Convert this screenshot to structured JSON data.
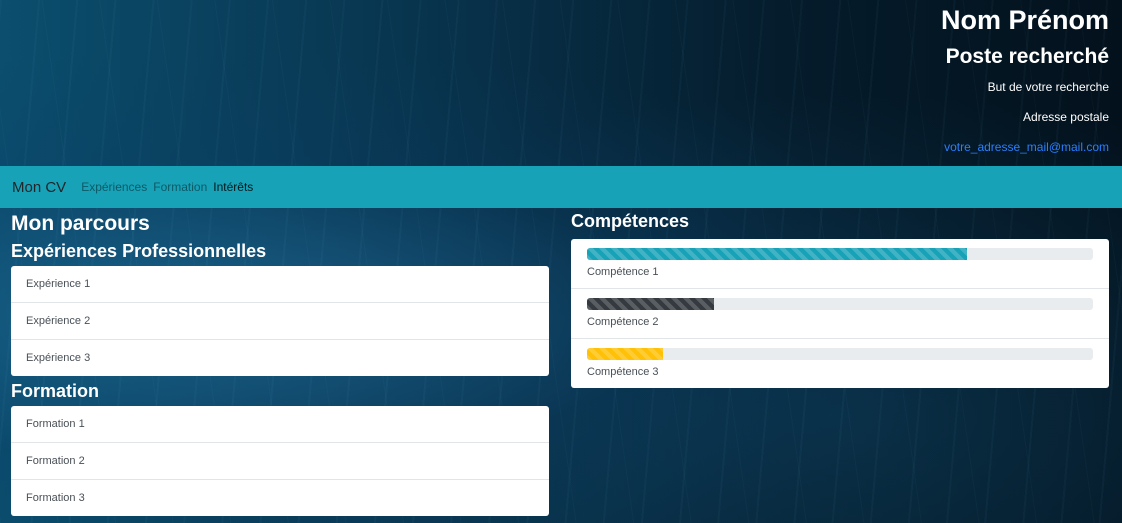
{
  "header": {
    "name": "Nom Prénom",
    "job": "Poste recherché",
    "goal": "But de votre recherche",
    "address": "Adresse postale",
    "email": "votre_adresse_mail@mail.com"
  },
  "nav": {
    "brand": "Mon CV",
    "links": [
      "Expériences",
      "Formation",
      "Intérêts"
    ]
  },
  "parcours": {
    "title": "Mon parcours",
    "experiences_title": "Expériences Professionnelles",
    "experiences": [
      "Expérience 1",
      "Expérience 2",
      "Expérience 3"
    ],
    "formation_title": "Formation",
    "formations": [
      "Formation 1",
      "Formation 2",
      "Formation 3"
    ]
  },
  "competences": {
    "title": "Compétences",
    "items": [
      {
        "label": "Compétence 1",
        "level": 0.75,
        "color": "#17a2b8"
      },
      {
        "label": "Compétence 2",
        "level": 0.25,
        "color": "#343a40"
      },
      {
        "label": "Compétence 3",
        "level": 0.15,
        "color": "#ffc107"
      }
    ]
  },
  "colors": {
    "navbar": "#17a2b8",
    "email_link": "#2a7fff"
  }
}
